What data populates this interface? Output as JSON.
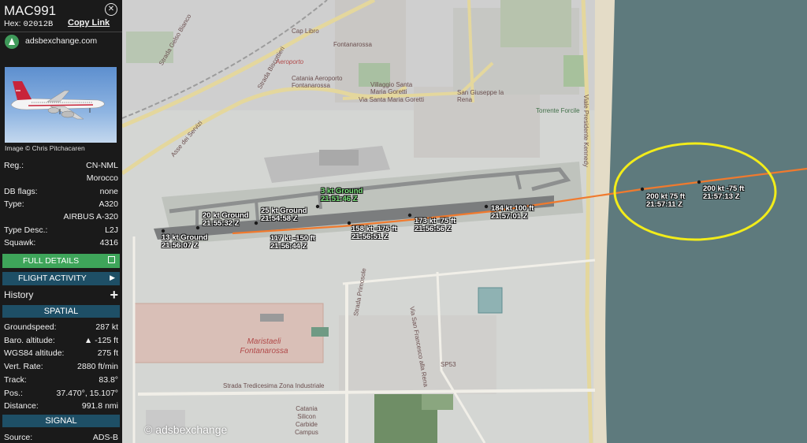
{
  "header": {
    "callsign": "MAC991",
    "hex_label": "Hex:",
    "hex": "02012B",
    "copy_link": "Copy Link",
    "brand": "adsbexchange.com",
    "photo_credit": "Image © Chris Pitchacaren"
  },
  "aircraft": {
    "rows": [
      {
        "label": "Reg.:",
        "value": "CN-NML"
      },
      {
        "label": "",
        "value": "Morocco"
      },
      {
        "label": "DB flags:",
        "value": "none"
      },
      {
        "label": "Type:",
        "value": "A320"
      },
      {
        "label": "",
        "value": "AIRBUS A-320"
      },
      {
        "label": "Type Desc.:",
        "value": "L2J"
      },
      {
        "label": "Squawk:",
        "value": "4316"
      }
    ]
  },
  "buttons": {
    "full_details": "FULL DETAILS",
    "flight_activity": "FLIGHT ACTIVITY",
    "history": "History"
  },
  "spatial": {
    "title": "SPATIAL",
    "rows": [
      {
        "label": "Groundspeed:",
        "value": "287 kt"
      },
      {
        "label": "Baro. altitude:",
        "value": "▲ -125 ft"
      },
      {
        "label": "WGS84 altitude:",
        "value": "275 ft"
      },
      {
        "label": "Vert. Rate:",
        "value": "2880 ft/min"
      },
      {
        "label": "Track:",
        "value": "83.8°"
      },
      {
        "label": "Pos.:",
        "value": "37.470°, 15.107°"
      },
      {
        "label": "Distance:",
        "value": "991.8 nmi"
      }
    ]
  },
  "signal": {
    "title": "SIGNAL",
    "rows": [
      {
        "label": "Source:",
        "value": "ADS-B"
      }
    ]
  },
  "map": {
    "copyright": "© adsbexchange",
    "colors": {
      "water": "#5e7a7d",
      "track": "#f07a2e",
      "highlight": "#f2ec1a",
      "ground_text": "#7be27b"
    },
    "labels": {
      "aeroporto": "Aeroporto",
      "catania_airport": "Catania Aeroporto Fontanarossa",
      "fontanarossa": "Fontanarossa",
      "villaggio": "Villaggio Santa Maria Goretti",
      "via_smg": "Via Santa Maria Goretti",
      "san_giuseppe": "San Giuseppe la Rena",
      "maristaeli": "Maristaeli Fontanarossa",
      "viale_kennedy": "Viale Presidente Kennedy",
      "strada_gelso": "Strada Gelso Bianco",
      "zona_industriale": "Strada Tredicesima Zona Industriale",
      "catania_silicon": "Catania Silicon Carbide Campus",
      "torrente": "Torrente Forcile",
      "sp53": "SP53",
      "via_sf": "Via San Francesco alla Rena",
      "strada_primosole": "Strada Primosole",
      "canalicchio": "Cap Libro",
      "asse": "Asse dei Servizi",
      "biscottieri": "Strada Biscottieri"
    },
    "flight_points": [
      {
        "line1": "13 kt  Ground",
        "line2": "21:56:07 Z",
        "ground": false
      },
      {
        "line1": "20 kt  Ground",
        "line2": "21:55:32 Z",
        "ground": false
      },
      {
        "line1": "25 kt  Ground",
        "line2": "21:54:58 Z",
        "ground": false
      },
      {
        "line1": "3 kt  Ground",
        "line2": "21:51:46 Z",
        "ground": true
      },
      {
        "line1": "117 kt  -150 ft",
        "line2": "21:56:44 Z",
        "ground": false
      },
      {
        "line1": "158 kt  -175 ft",
        "line2": "21:56:51 Z",
        "ground": false
      },
      {
        "line1": "173 kt  -75 ft",
        "line2": "21:56:56 Z",
        "ground": false
      },
      {
        "line1": "184 kt  100 ft",
        "line2": "21:57:01 Z",
        "ground": false
      },
      {
        "line1": "200 kt   75 ft",
        "line2": "21:57:11 Z",
        "ground": false
      },
      {
        "line1": "200 kt  -75 ft",
        "line2": "21:57:13 Z",
        "ground": false
      }
    ]
  }
}
